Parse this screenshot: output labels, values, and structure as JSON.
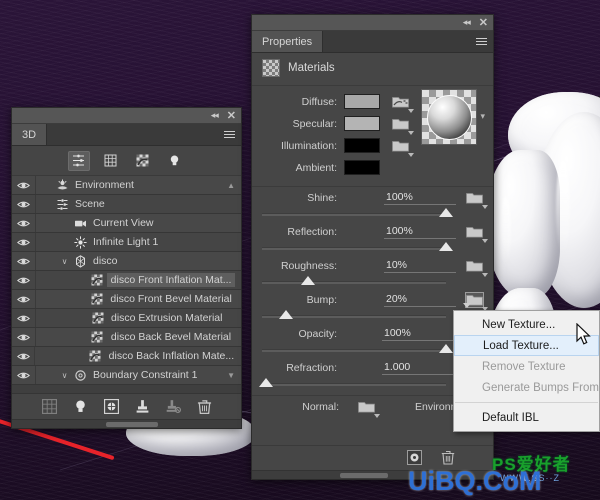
{
  "background": {
    "canvas_color": "#241030",
    "axis_red": "#e8232a"
  },
  "panel_3d": {
    "title": "3D",
    "collapse_label": "◂◂",
    "close_label": "✕",
    "filters": [
      {
        "name": "scene-filter-icon",
        "label": "Scene",
        "active": true
      },
      {
        "name": "mesh-filter-icon",
        "label": "Meshes",
        "active": false
      },
      {
        "name": "materials-filter-icon",
        "label": "Materials",
        "active": false
      },
      {
        "name": "lights-filter-icon",
        "label": "Lights",
        "active": false
      }
    ],
    "rows": [
      {
        "label": "Environment",
        "icon": "environment-icon",
        "indent": 0,
        "visible": true,
        "twisty": "",
        "selected": false,
        "caret": "▲"
      },
      {
        "label": "Scene",
        "icon": "scene-icon",
        "indent": 0,
        "visible": true,
        "twisty": "",
        "selected": false,
        "caret": ""
      },
      {
        "label": "Current View",
        "icon": "camera-icon",
        "indent": 1,
        "visible": true,
        "twisty": "",
        "selected": false,
        "caret": ""
      },
      {
        "label": "Infinite Light 1",
        "icon": "light-icon",
        "indent": 1,
        "visible": true,
        "twisty": "",
        "selected": false,
        "caret": ""
      },
      {
        "label": "disco",
        "icon": "mesh-icon",
        "indent": 1,
        "visible": true,
        "twisty": "∨",
        "selected": false,
        "caret": ""
      },
      {
        "label": "disco Front Inflation Mat...",
        "icon": "material-icon",
        "indent": 2,
        "visible": true,
        "twisty": "",
        "selected": true,
        "caret": ""
      },
      {
        "label": "disco Front Bevel Material",
        "icon": "material-icon",
        "indent": 2,
        "visible": true,
        "twisty": "",
        "selected": false,
        "caret": ""
      },
      {
        "label": "disco Extrusion Material",
        "icon": "material-icon",
        "indent": 2,
        "visible": true,
        "twisty": "",
        "selected": false,
        "caret": ""
      },
      {
        "label": "disco Back Bevel Material",
        "icon": "material-icon",
        "indent": 2,
        "visible": true,
        "twisty": "",
        "selected": false,
        "caret": ""
      },
      {
        "label": "disco Back Inflation Mate...",
        "icon": "material-icon",
        "indent": 2,
        "visible": true,
        "twisty": "",
        "selected": false,
        "caret": ""
      },
      {
        "label": "Boundary Constraint 1",
        "icon": "constraint-icon",
        "indent": 1,
        "visible": true,
        "twisty": "∨",
        "selected": false,
        "caret": "▼"
      }
    ],
    "footer_buttons": [
      {
        "name": "add-mesh-button",
        "label": "Add Mesh",
        "dim": true
      },
      {
        "name": "add-light-button",
        "label": "Add Light",
        "dim": false
      },
      {
        "name": "add-ibl-button",
        "label": "Add IBL",
        "dim": false
      },
      {
        "name": "paint-falloff-button",
        "label": "Paint Falloff",
        "dim": false
      },
      {
        "name": "paint-falloff-off-button",
        "label": "Paint Falloff Off",
        "dim": true
      },
      {
        "name": "delete-button",
        "label": "Delete",
        "dim": false
      }
    ]
  },
  "properties": {
    "tab_label": "Properties",
    "collapse_label": "◂◂",
    "close_label": "✕",
    "section_title": "Materials",
    "swatches": [
      {
        "label": "Diffuse:",
        "color": "#a8a8a8",
        "has_texture": true
      },
      {
        "label": "Specular:",
        "color": "#b4b4b4",
        "has_texture": false
      },
      {
        "label": "Illumination:",
        "color": "#000000",
        "has_texture": false
      },
      {
        "label": "Ambient:",
        "color": "#000000",
        "has_texture": false
      }
    ],
    "sliders": [
      {
        "label": "Shine:",
        "value": "100%",
        "fill": 100,
        "folder": true
      },
      {
        "label": "Reflection:",
        "value": "100%",
        "fill": 100,
        "folder": true
      },
      {
        "label": "Roughness:",
        "value": "10%",
        "fill": 25,
        "folder": true
      },
      {
        "label": "Bump:",
        "value": "20%",
        "fill": 13,
        "folder": true,
        "folder_active": true
      },
      {
        "label": "Opacity:",
        "value": "100%",
        "fill": 100,
        "folder": false
      },
      {
        "label": "Refraction:",
        "value": "1.000",
        "fill": 2,
        "folder": false
      }
    ],
    "normal_label": "Normal:",
    "environment_label": "Environment:",
    "footer_buttons": [
      {
        "name": "new-material-button",
        "label": "New Material"
      },
      {
        "name": "delete-material-button",
        "label": "Delete Material"
      }
    ]
  },
  "context_menu": {
    "items": [
      {
        "label": "New Texture...",
        "state": "normal"
      },
      {
        "label": "Load Texture...",
        "state": "highlight"
      },
      {
        "label": "Remove Texture",
        "state": "disabled"
      },
      {
        "label": "Generate Bumps From...",
        "state": "disabled"
      },
      {
        "label": "SEP",
        "state": "separator"
      },
      {
        "label": "Default IBL",
        "state": "normal"
      }
    ]
  },
  "watermark": {
    "site": "UiBQ.CoM",
    "brand": "PS爱好者",
    "url": "WWW.SS··Z"
  }
}
